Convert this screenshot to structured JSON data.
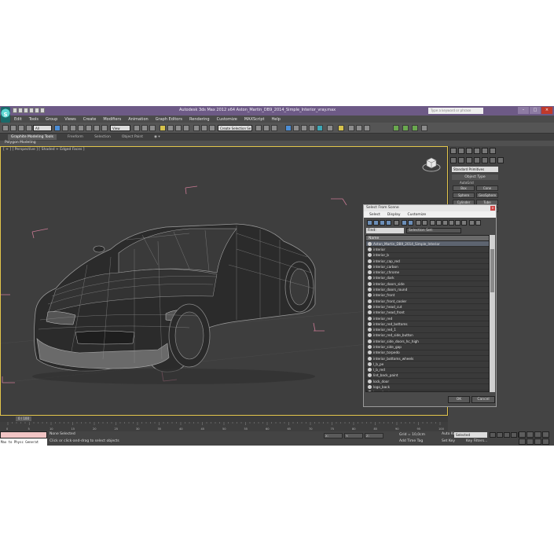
{
  "window": {
    "title": "Autodesk 3ds Max 2012 x64     Aston_Martin_DB9_2014_Simple_Interior_vray.max",
    "help_search_placeholder": "Type a keyword or phrase",
    "logo": "3ds-max-logo"
  },
  "menu": [
    "Edit",
    "Tools",
    "Group",
    "Views",
    "Create",
    "Modifiers",
    "Animation",
    "Graph Editors",
    "Rendering",
    "Customize",
    "MAXScript",
    "Help"
  ],
  "toolbar": {
    "selection_filter": "All",
    "reference_coord": "View",
    "named_selection": "Create Selection Se"
  },
  "ribbon": {
    "tabs": [
      "Graphite Modeling Tools",
      "Freeform",
      "Selection",
      "Object Paint"
    ],
    "active_tab": "Graphite Modeling Tools",
    "panel_label": "Polygon Modeling"
  },
  "viewport": {
    "label": "[ + ] [ Perspective ] [ Shaded + Edged Faces ]",
    "accent_color": "#e3c64b"
  },
  "command_panel": {
    "dropdown": "Standard Primitives",
    "section_header": "Object Type",
    "autogrid": "AutoGrid",
    "buttons": [
      "Box",
      "Cone",
      "Sphere",
      "GeoSphere",
      "Cylinder",
      "Tube",
      "Torus",
      "Pyramid"
    ]
  },
  "dialog": {
    "title": "Select From Scene",
    "close": "×",
    "menu": [
      "Select",
      "Display",
      "Customize"
    ],
    "find_label": "Find:",
    "selection_set_label": "Selection Set:",
    "column_header": "Name",
    "selected_index": 0,
    "items": [
      "Aston_Martin_DB9_2014_Simple_Interior",
      "interior",
      "interior_b",
      "interior_cap_red",
      "interior_carbon",
      "interior_chrome",
      "interior_dark",
      "interior_doors_side",
      "interior_doors_round",
      "interior_front",
      "interior_front_cooler",
      "interior_head_cut",
      "interior_head_front",
      "interior_red",
      "interior_red_bottoms",
      "interior_red_1",
      "interior_red_side_button",
      "interior_side_doors_hc_high",
      "interior_side_gap",
      "interior_torpedo",
      "interior_bottoms_wheels",
      "l_b_pe",
      "l_b_red",
      "lint_back_paint",
      "lock_door",
      "logo_back",
      "logo_front",
      "logo_interior",
      "mirror_l"
    ],
    "ok": "OK",
    "cancel": "Cancel"
  },
  "timeline": {
    "slider_label": "0 / 100",
    "ticks": [
      "0",
      "5",
      "10",
      "15",
      "20",
      "25",
      "30",
      "35",
      "40",
      "45",
      "50",
      "55",
      "60",
      "65",
      "70",
      "75",
      "80",
      "85",
      "90",
      "95",
      "100"
    ]
  },
  "status": {
    "maxscript_output": "Max to Physc Generat",
    "selection": "None Selected",
    "prompt": "Click or click-and-drag to select objects",
    "coords": [
      "X:",
      "Y:",
      "Z:"
    ],
    "grid": "Grid = 10,0cm",
    "add_time_tag": "Add Time Tag",
    "auto_key": "Auto Key",
    "auto_key_value": "Selected",
    "set_key": "Set Key",
    "key_filters": "Key Filters..."
  }
}
